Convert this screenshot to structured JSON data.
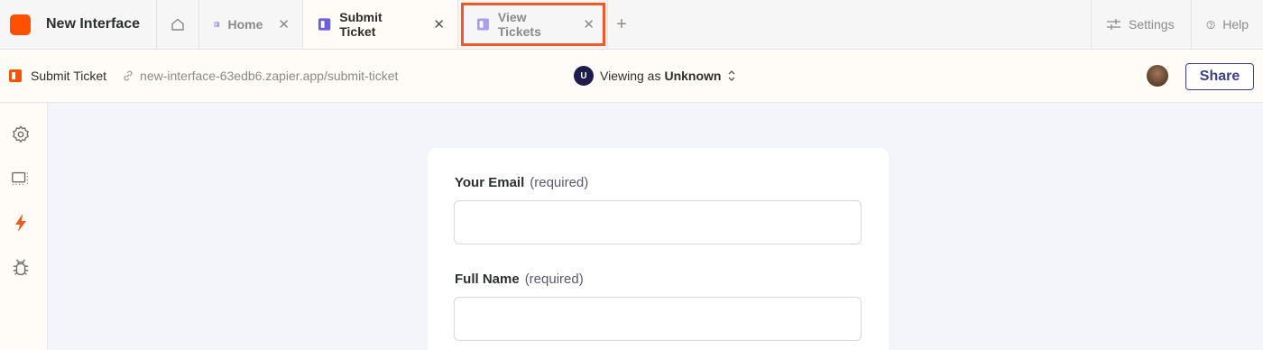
{
  "app": {
    "name": "New Interface",
    "brand_color": "#ff4f00"
  },
  "tabs": [
    {
      "label": "Home",
      "active": false
    },
    {
      "label": "Submit Ticket",
      "active": true
    },
    {
      "label": "View Tickets",
      "active": false,
      "highlighted": true
    }
  ],
  "topbar": {
    "settings_label": "Settings",
    "help_label": "Help"
  },
  "subbar": {
    "page_name": "Submit Ticket",
    "url": "new-interface-63edb6.zapier.app/submit-ticket",
    "viewing_prefix": "Viewing as",
    "viewing_user": "Unknown",
    "viewing_badge": "U",
    "share_label": "Share"
  },
  "rail": {
    "items": [
      "gear-icon",
      "layout-icon",
      "bolt-icon",
      "bug-icon"
    ]
  },
  "form": {
    "fields": [
      {
        "label": "Your Email",
        "required_text": "(required)",
        "value": ""
      },
      {
        "label": "Full Name",
        "required_text": "(required)",
        "value": ""
      }
    ]
  },
  "colors": {
    "accent": "#3b3f86",
    "highlight": "#f15a22",
    "tab_icon": "#6d5fd8"
  }
}
